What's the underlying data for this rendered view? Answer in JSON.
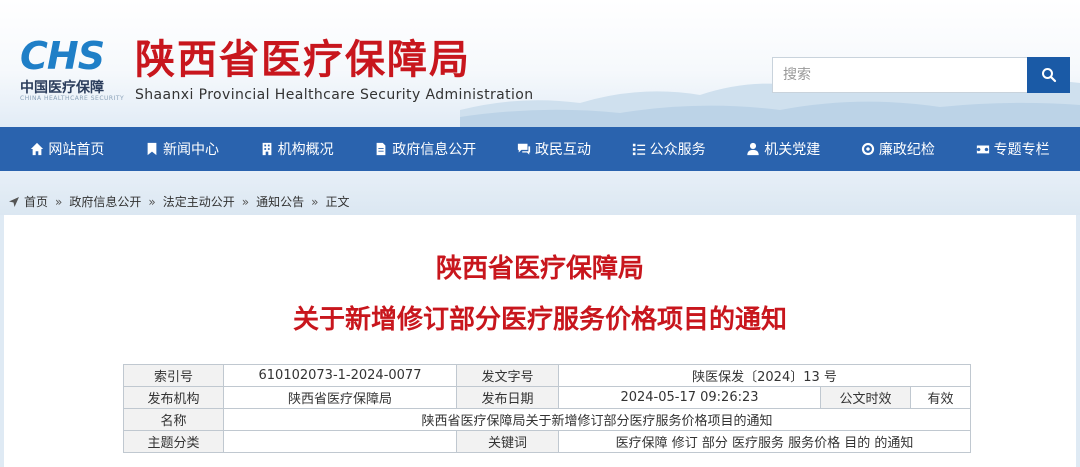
{
  "header": {
    "logo_mark": "CHS",
    "logo_cn": "中国医疗保障",
    "logo_en": "CHINA HEALTHCARE SECURITY",
    "title_cn": "陕西省医疗保障局",
    "title_en": "Shaanxi Provincial Healthcare Security Administration",
    "title_color": "#c8161d",
    "search": {
      "placeholder": "搜索"
    }
  },
  "nav": {
    "items": [
      {
        "label": "网站首页",
        "icon": "home-icon"
      },
      {
        "label": "新闻中心",
        "icon": "bookmark-icon"
      },
      {
        "label": "机构概况",
        "icon": "building-icon"
      },
      {
        "label": "政府信息公开",
        "icon": "document-icon"
      },
      {
        "label": "政民互动",
        "icon": "chat-icon"
      },
      {
        "label": "公众服务",
        "icon": "list-icon"
      },
      {
        "label": "机关党建",
        "icon": "user-icon"
      },
      {
        "label": "廉政纪检",
        "icon": "target-icon"
      },
      {
        "label": "专题专栏",
        "icon": "binoculars-icon"
      }
    ],
    "bg_color": "#2a63ae"
  },
  "breadcrumb": [
    "首页",
    "政府信息公开",
    "法定主动公开",
    "通知公告",
    "正文"
  ],
  "article": {
    "title_line1": "陕西省医疗保障局",
    "title_line2": "关于新增修订部分医疗服务价格项目的通知"
  },
  "meta": {
    "index_label": "索引号",
    "index_value": "610102073-1-2024-0077",
    "docno_label": "发文字号",
    "docno_value": "陕医保发〔2024〕13 号",
    "issuer_label": "发布机构",
    "issuer_value": "陕西省医疗保障局",
    "date_label": "发布日期",
    "date_value": "2024-05-17 09:26:23",
    "validity_label": "公文时效",
    "validity_value": "有效",
    "name_label": "名称",
    "name_value": "陕西省医疗保障局关于新增修订部分医疗服务价格项目的通知",
    "topic_label": "主题分类",
    "topic_value": "",
    "keywords_label": "关键词",
    "keywords_value": "医疗保障 修订 部分 医疗服务 服务价格 目的 的通知"
  }
}
